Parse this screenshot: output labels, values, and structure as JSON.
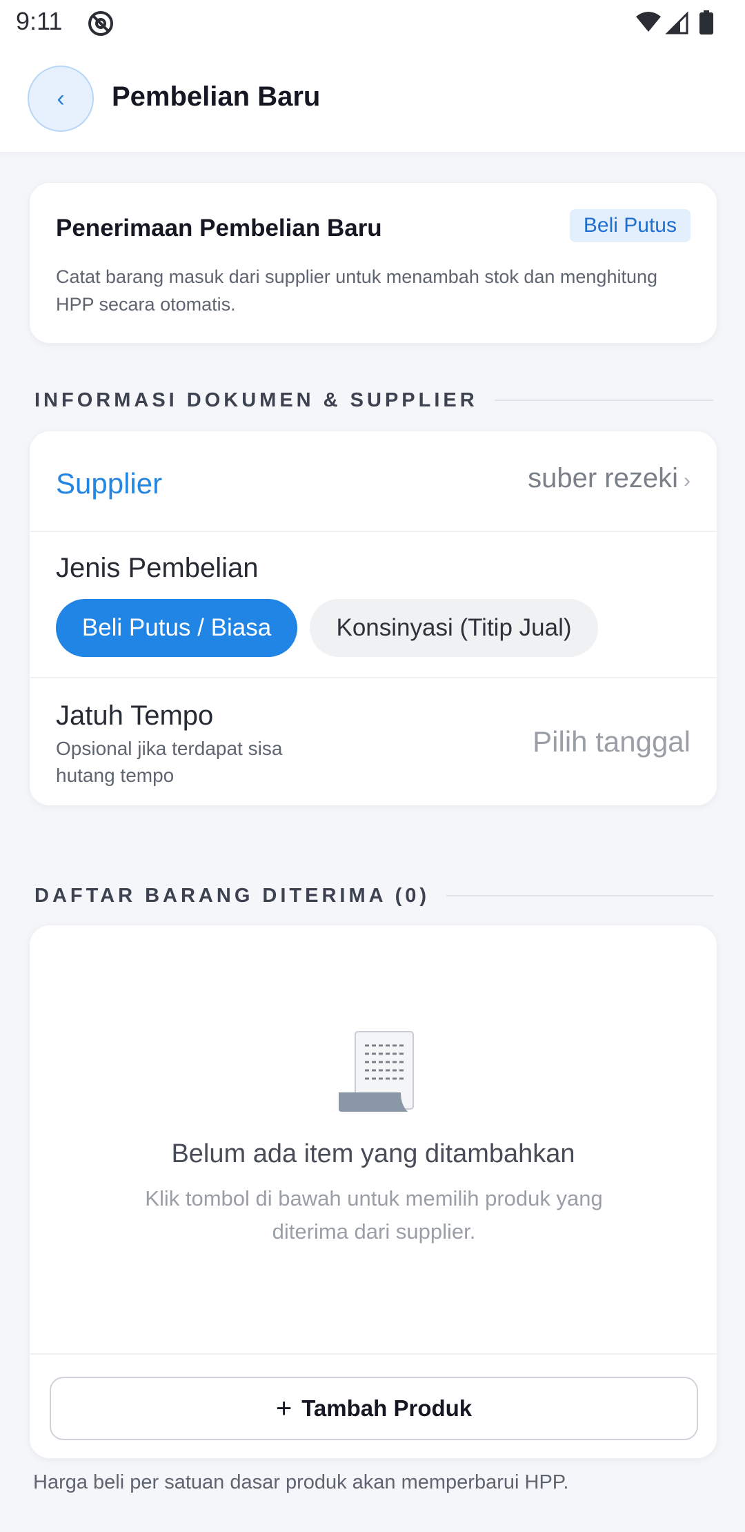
{
  "status_bar": {
    "time": "9:11"
  },
  "app_bar": {
    "back_icon": "‹",
    "title": "Pembelian Baru"
  },
  "intro": {
    "title": "Penerimaan Pembelian Baru",
    "badge": "Beli Putus",
    "description": "Catat barang masuk dari supplier untuk menambah stok dan menghitung HPP secara otomatis."
  },
  "doc_section": {
    "header": "INFORMASI DOKUMEN & SUPPLIER",
    "supplier_label": "Supplier",
    "supplier_value": "suber rezeki",
    "jenis_label": "Jenis Pembelian",
    "jenis_options": [
      "Beli Putus / Biasa",
      "Konsinyasi (Titip Jual)"
    ],
    "jenis_selected": "Beli Putus / Biasa",
    "tempo_label": "Jatuh Tempo",
    "tempo_hint": "Opsional jika terdapat sisa hutang tempo",
    "tempo_placeholder": "Pilih tanggal"
  },
  "items_section": {
    "header": "DAFTAR BARANG DITERIMA (0)",
    "empty_title": "Belum ada item yang ditambahkan",
    "empty_desc": "Klik tombol di bawah untuk memilih produk yang diterima dari supplier.",
    "add_button_label": "Tambah Produk"
  },
  "footer_note": "Harga beli per satuan dasar produk akan memperbarui HPP.",
  "colors": {
    "accent": "#2185e6",
    "supplier_label": "#2486e0",
    "badge_bg": "#e3effc",
    "page_bg": "#f4f6f9"
  }
}
